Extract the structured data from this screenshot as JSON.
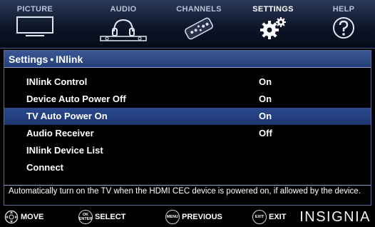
{
  "tabs": [
    {
      "label": "PICTURE"
    },
    {
      "label": "AUDIO"
    },
    {
      "label": "CHANNELS"
    },
    {
      "label": "SETTINGS"
    },
    {
      "label": "HELP"
    }
  ],
  "breadcrumb": {
    "section": "Settings",
    "separator": "•",
    "page": "INlink"
  },
  "menu": [
    {
      "label": "INlink Control",
      "value": "On"
    },
    {
      "label": "Device Auto Power Off",
      "value": "On"
    },
    {
      "label": "TV Auto Power On",
      "value": "On",
      "selected": true
    },
    {
      "label": "Audio Receiver",
      "value": "Off"
    },
    {
      "label": "INlink Device List",
      "value": ""
    },
    {
      "label": "Connect",
      "value": ""
    }
  ],
  "help_text": "Automatically turn on the TV when the HDMI CEC device is powered on, if allowed by the device.",
  "footer": {
    "move": "MOVE",
    "ok_button": "OK\nENTER",
    "select": "SELECT",
    "menu_button": "MENU",
    "previous": "PREVIOUS",
    "exit_button": "EXIT",
    "exit": "EXIT",
    "brand": "INSIGNIA"
  },
  "colors": {
    "header_blue": "#2c4a88",
    "highlight": "#23407a"
  }
}
